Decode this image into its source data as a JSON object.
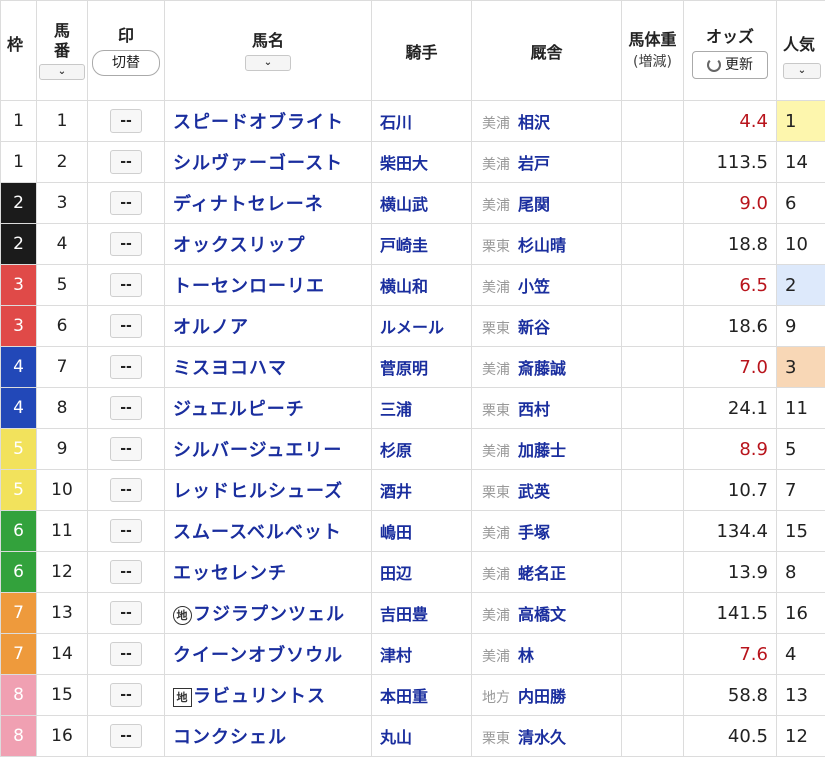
{
  "header": {
    "waku": "枠",
    "umaban": "馬番",
    "mark": "印",
    "mark_toggle": "切替",
    "horse_name": "馬名",
    "jockey": "騎手",
    "trainer": "厩舎",
    "weight": "馬体重",
    "weight_sub": "(増減)",
    "odds": "オッズ",
    "refresh": "更新",
    "popularity": "人気",
    "sort_glyph": "⌄"
  },
  "colors": {
    "horse_link": "#1a2e9e",
    "odds_favorite": "#b8141c",
    "odds_normal": "#222222",
    "pop_1": "#fdf6ad",
    "pop_2": "#dde9fb",
    "pop_3": "#f8d7b6"
  },
  "waku_colors": {
    "1": {
      "bg": "#ffffff",
      "fg": "#222222"
    },
    "2": {
      "bg": "#1b1b1b",
      "fg": "#ffffff"
    },
    "3": {
      "bg": "#e04a48",
      "fg": "#ffffff"
    },
    "4": {
      "bg": "#2248b8",
      "fg": "#ffffff"
    },
    "5": {
      "bg": "#f2e25c",
      "fg": "#ffffff"
    },
    "6": {
      "bg": "#33a23c",
      "fg": "#ffffff"
    },
    "7": {
      "bg": "#ee9a3c",
      "fg": "#ffffff"
    },
    "8": {
      "bg": "#f0a0b2",
      "fg": "#ffffff"
    }
  },
  "horses": [
    {
      "waku": "1",
      "num": "1",
      "mark": "--",
      "badge": "",
      "name": "スピードオブライト",
      "jockey": "石川",
      "region": "美浦",
      "trainer": "相沢",
      "weight": "",
      "odds": "4.4",
      "odds_hot": true,
      "pop": "1",
      "pop_hl": "pop_1"
    },
    {
      "waku": "1",
      "num": "2",
      "mark": "--",
      "badge": "",
      "name": "シルヴァーゴースト",
      "jockey": "柴田大",
      "region": "美浦",
      "trainer": "岩戸",
      "weight": "",
      "odds": "113.5",
      "odds_hot": false,
      "pop": "14",
      "pop_hl": ""
    },
    {
      "waku": "2",
      "num": "3",
      "mark": "--",
      "badge": "",
      "name": "ディナトセレーネ",
      "jockey": "横山武",
      "region": "美浦",
      "trainer": "尾関",
      "weight": "",
      "odds": "9.0",
      "odds_hot": true,
      "pop": "6",
      "pop_hl": ""
    },
    {
      "waku": "2",
      "num": "4",
      "mark": "--",
      "badge": "",
      "name": "オックスリップ",
      "jockey": "戸崎圭",
      "region": "栗東",
      "trainer": "杉山晴",
      "weight": "",
      "odds": "18.8",
      "odds_hot": false,
      "pop": "10",
      "pop_hl": ""
    },
    {
      "waku": "3",
      "num": "5",
      "mark": "--",
      "badge": "",
      "name": "トーセンローリエ",
      "jockey": "横山和",
      "region": "美浦",
      "trainer": "小笠",
      "weight": "",
      "odds": "6.5",
      "odds_hot": true,
      "pop": "2",
      "pop_hl": "pop_2"
    },
    {
      "waku": "3",
      "num": "6",
      "mark": "--",
      "badge": "",
      "name": "オルノア",
      "jockey": "ルメール",
      "region": "栗東",
      "trainer": "新谷",
      "weight": "",
      "odds": "18.6",
      "odds_hot": false,
      "pop": "9",
      "pop_hl": ""
    },
    {
      "waku": "4",
      "num": "7",
      "mark": "--",
      "badge": "",
      "name": "ミスヨコハマ",
      "jockey": "菅原明",
      "region": "美浦",
      "trainer": "斎藤誠",
      "weight": "",
      "odds": "7.0",
      "odds_hot": true,
      "pop": "3",
      "pop_hl": "pop_3"
    },
    {
      "waku": "4",
      "num": "8",
      "mark": "--",
      "badge": "",
      "name": "ジュエルピーチ",
      "jockey": "三浦",
      "region": "栗東",
      "trainer": "西村",
      "weight": "",
      "odds": "24.1",
      "odds_hot": false,
      "pop": "11",
      "pop_hl": ""
    },
    {
      "waku": "5",
      "num": "9",
      "mark": "--",
      "badge": "",
      "name": "シルバージュエリー",
      "jockey": "杉原",
      "region": "美浦",
      "trainer": "加藤士",
      "weight": "",
      "odds": "8.9",
      "odds_hot": true,
      "pop": "5",
      "pop_hl": ""
    },
    {
      "waku": "5",
      "num": "10",
      "mark": "--",
      "badge": "",
      "name": "レッドヒルシューズ",
      "jockey": "酒井",
      "region": "栗東",
      "trainer": "武英",
      "weight": "",
      "odds": "10.7",
      "odds_hot": false,
      "pop": "7",
      "pop_hl": ""
    },
    {
      "waku": "6",
      "num": "11",
      "mark": "--",
      "badge": "",
      "name": "スムースベルベット",
      "jockey": "嶋田",
      "region": "美浦",
      "trainer": "手塚",
      "weight": "",
      "odds": "134.4",
      "odds_hot": false,
      "pop": "15",
      "pop_hl": ""
    },
    {
      "waku": "6",
      "num": "12",
      "mark": "--",
      "badge": "",
      "name": "エッセレンチ",
      "jockey": "田辺",
      "region": "美浦",
      "trainer": "蛯名正",
      "weight": "",
      "odds": "13.9",
      "odds_hot": false,
      "pop": "8",
      "pop_hl": ""
    },
    {
      "waku": "7",
      "num": "13",
      "mark": "--",
      "badge": "地",
      "badge_shape": "circle",
      "name": "フジラプンツェル",
      "jockey": "吉田豊",
      "region": "美浦",
      "trainer": "高橋文",
      "weight": "",
      "odds": "141.5",
      "odds_hot": false,
      "pop": "16",
      "pop_hl": ""
    },
    {
      "waku": "7",
      "num": "14",
      "mark": "--",
      "badge": "",
      "name": "クイーンオブソウル",
      "jockey": "津村",
      "region": "美浦",
      "trainer": "林",
      "weight": "",
      "odds": "7.6",
      "odds_hot": true,
      "pop": "4",
      "pop_hl": ""
    },
    {
      "waku": "8",
      "num": "15",
      "mark": "--",
      "badge": "地",
      "badge_shape": "square",
      "name": "ラビュリントス",
      "jockey": "本田重",
      "region": "地方",
      "trainer": "内田勝",
      "weight": "",
      "odds": "58.8",
      "odds_hot": false,
      "pop": "13",
      "pop_hl": ""
    },
    {
      "waku": "8",
      "num": "16",
      "mark": "--",
      "badge": "",
      "name": "コンクシェル",
      "jockey": "丸山",
      "region": "栗東",
      "trainer": "清水久",
      "weight": "",
      "odds": "40.5",
      "odds_hot": false,
      "pop": "12",
      "pop_hl": ""
    }
  ]
}
